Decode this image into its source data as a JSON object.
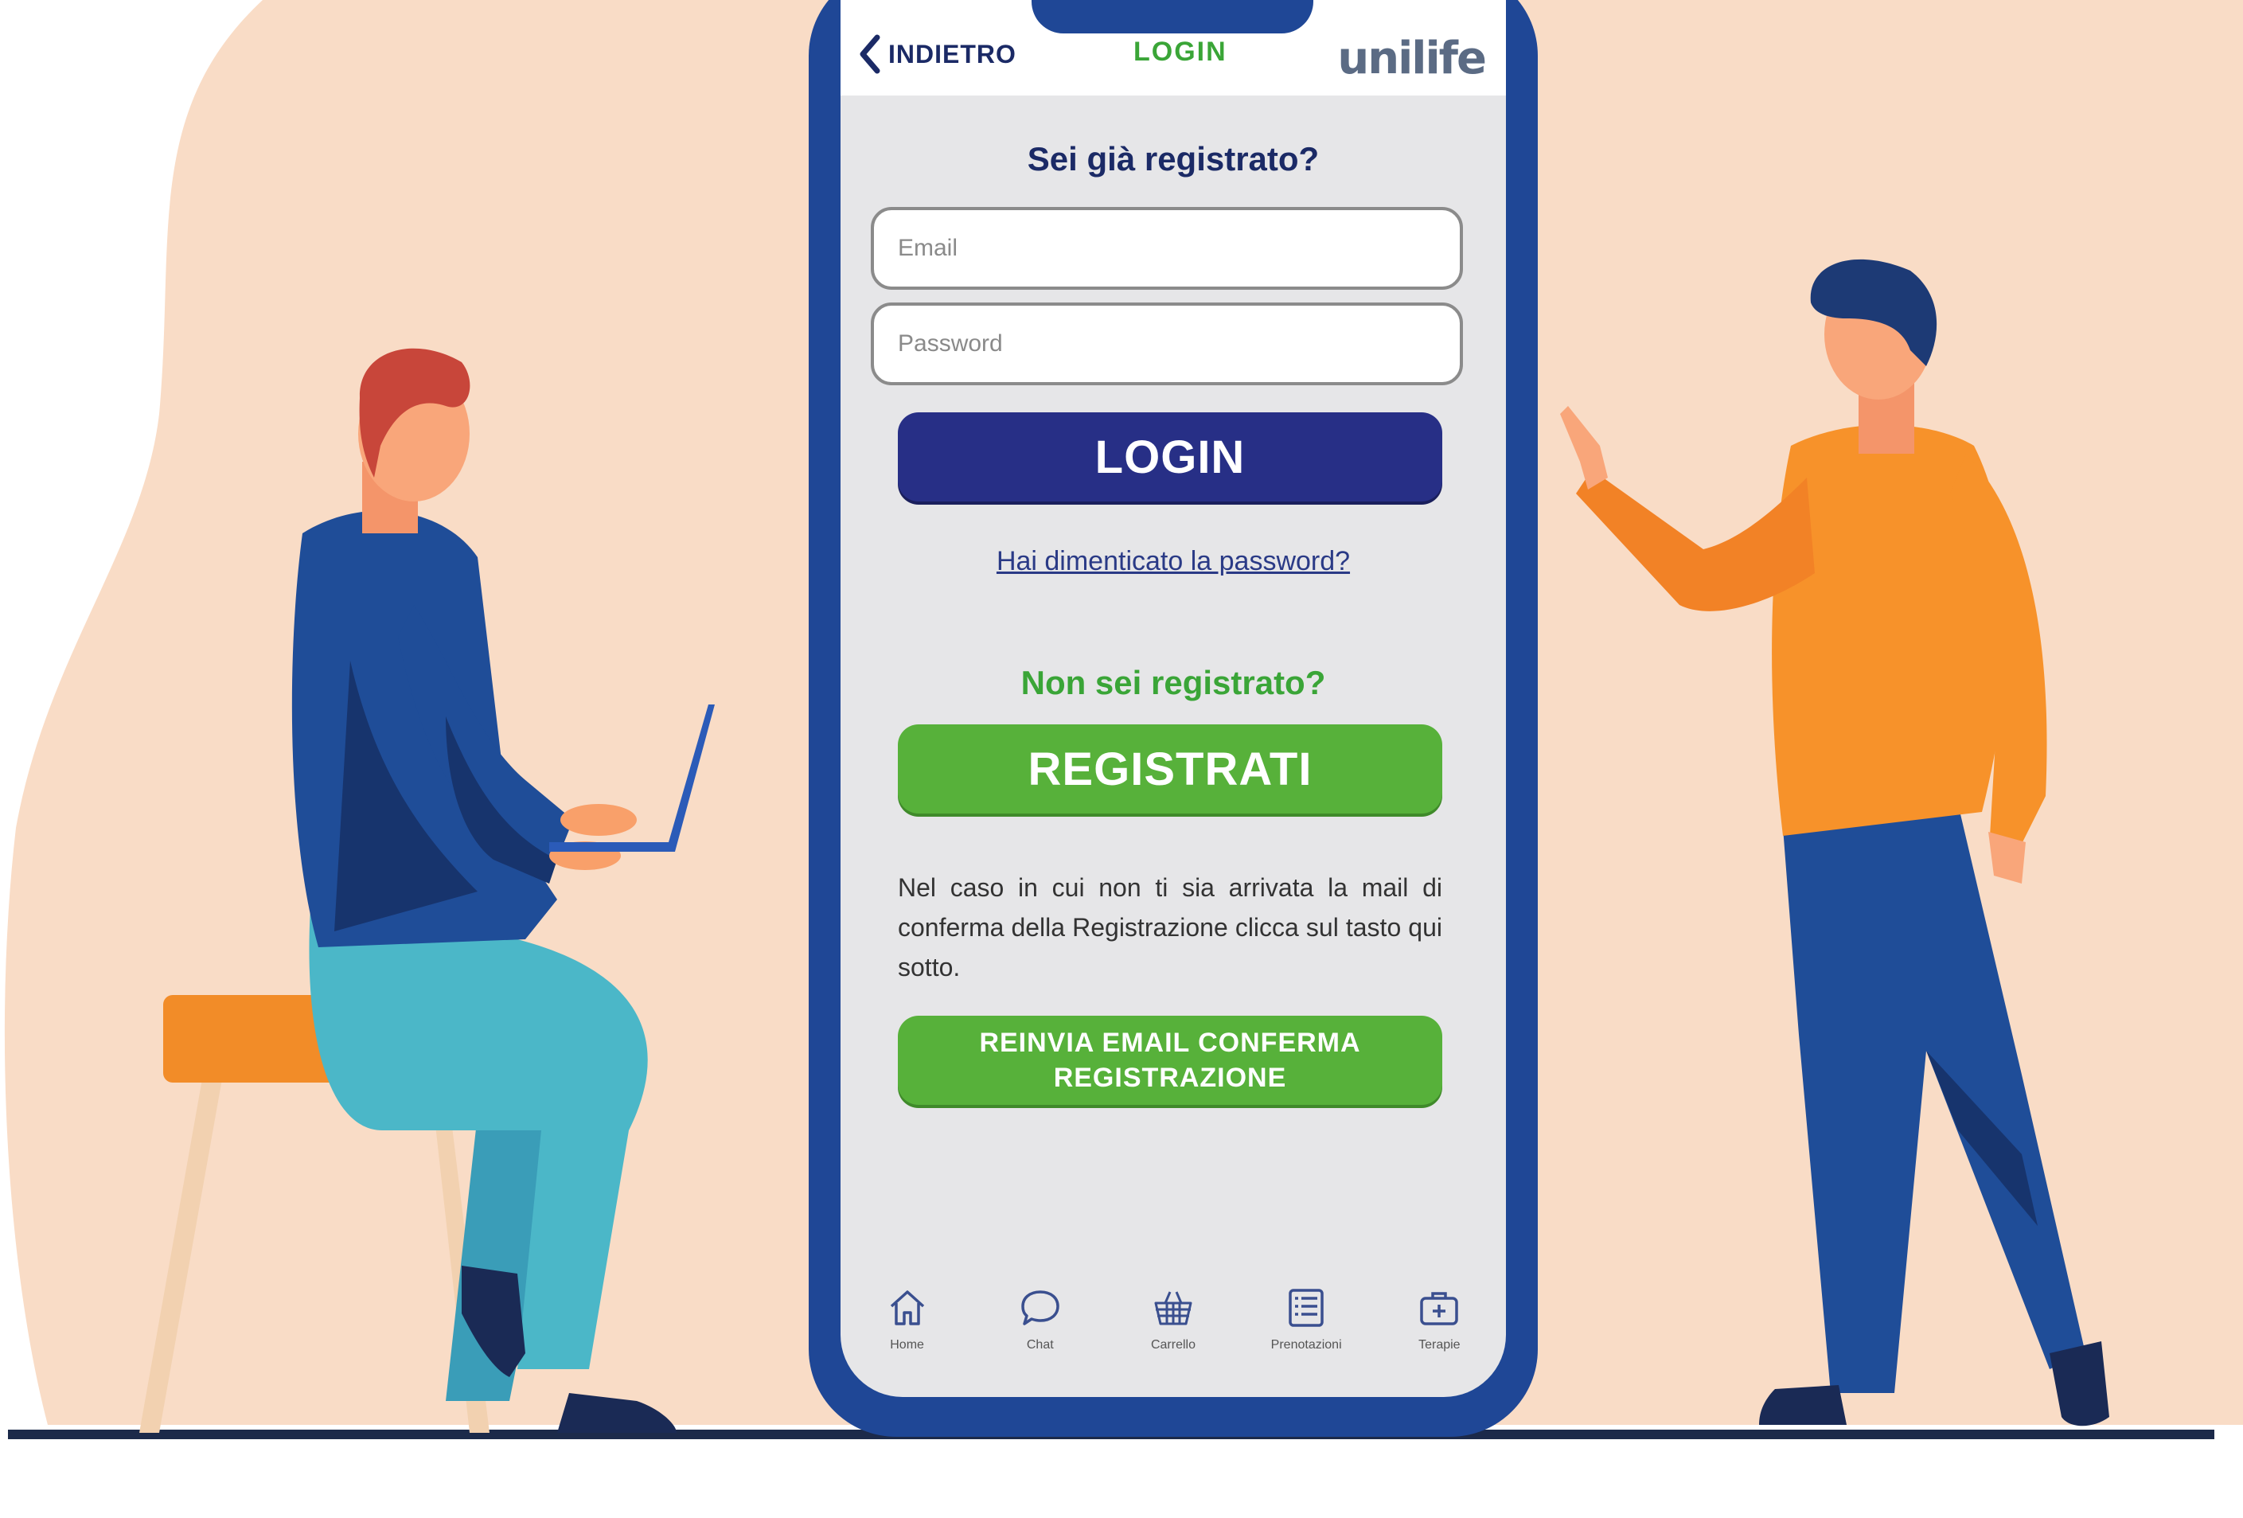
{
  "header": {
    "back_label": "INDIETRO",
    "title": "LOGIN",
    "logo_text": "unilife"
  },
  "login": {
    "heading": "Sei già registrato?",
    "email_placeholder": "Email",
    "password_placeholder": "Password",
    "login_button": "LOGIN",
    "forgot_link": "Hai dimenticato la password?"
  },
  "register": {
    "heading": "Non sei registrato?",
    "register_button": "REGISTRATI",
    "note": "Nel caso in cui non ti sia arrivata la mail di conferma della Registrazione clicca sul tasto qui sotto.",
    "resend_button": "REINVIA EMAIL CONFERMA REGISTRAZIONE"
  },
  "tabbar": {
    "items": [
      {
        "label": "Home",
        "icon": "home-icon"
      },
      {
        "label": "Chat",
        "icon": "chat-bubble-icon"
      },
      {
        "label": "Carrello",
        "icon": "basket-icon"
      },
      {
        "label": "Prenotazioni",
        "icon": "list-icon"
      },
      {
        "label": "Terapie",
        "icon": "medical-kit-icon"
      }
    ]
  },
  "colors": {
    "phone_frame": "#1f4796",
    "login_button": "#272f86",
    "green_accent": "#57b13a",
    "background_blob": "#f9dcc6"
  }
}
